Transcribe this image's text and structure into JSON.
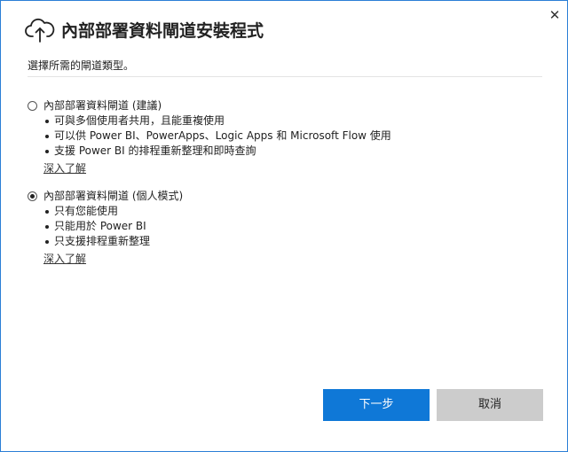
{
  "window": {
    "title": "內部部署資料閘道安裝程式",
    "close_symbol": "✕"
  },
  "subtitle": "選擇所需的閘道類型。",
  "options": [
    {
      "label": "內部部署資料閘道 (建議)",
      "selected": false,
      "bullets": [
        "可與多個使用者共用，且能重複使用",
        "可以供 Power BI、PowerApps、Logic Apps 和 Microsoft Flow 使用",
        "支援 Power BI 的排程重新整理和即時查詢"
      ],
      "link": "深入了解"
    },
    {
      "label": "內部部署資料閘道 (個人模式)",
      "selected": true,
      "bullets": [
        "只有您能使用",
        "只能用於 Power BI",
        "只支援排程重新整理"
      ],
      "link": "深入了解"
    }
  ],
  "buttons": {
    "next": "下一步",
    "cancel": "取消"
  },
  "colors": {
    "primary": "#0f78d7",
    "secondary": "#cccccc",
    "border": "#2b7fd6"
  },
  "icons": {
    "header": "cloud-upload-icon",
    "close": "close-icon"
  }
}
